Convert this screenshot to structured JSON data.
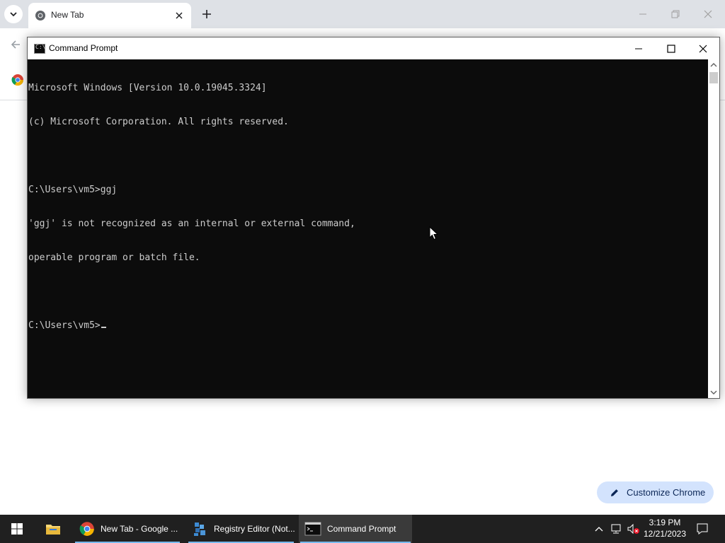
{
  "chrome": {
    "tab_title": "New Tab",
    "customize_label": "Customize Chrome"
  },
  "cmd": {
    "title": "Command Prompt",
    "lines": [
      "Microsoft Windows [Version 10.0.19045.3324]",
      "(c) Microsoft Corporation. All rights reserved.",
      "",
      "C:\\Users\\vm5>ggj",
      "'ggj' is not recognized as an internal or external command,",
      "operable program or batch file.",
      "",
      "C:\\Users\\vm5>"
    ]
  },
  "taskbar": {
    "items": [
      {
        "label": "New Tab - Google ...",
        "icon": "chrome-icon"
      },
      {
        "label": "Registry Editor (Not...",
        "icon": "registry-editor-icon"
      },
      {
        "label": "Command Prompt",
        "icon": "cmd-icon"
      }
    ],
    "clock": {
      "time": "3:19 PM",
      "date": "12/21/2023"
    }
  },
  "colors": {
    "accent": "#76b9ed",
    "console_bg": "#0c0c0c",
    "console_text": "#cccccc",
    "taskbar": "#202020",
    "chrome_frame": "#dee1e6",
    "customize_bg": "#d3e3fd"
  }
}
